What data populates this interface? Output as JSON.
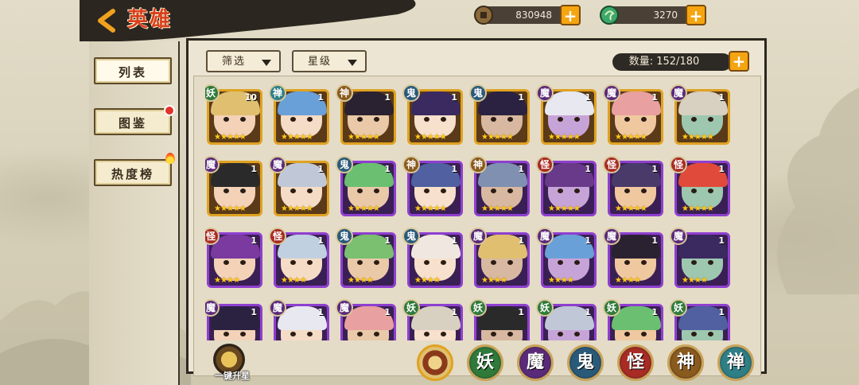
{
  "header": {
    "title": "英雄",
    "coins": "830948",
    "jade": "3270",
    "plus_label": "+"
  },
  "sidebar": {
    "items": [
      {
        "label": "列表"
      },
      {
        "label": "图鉴"
      },
      {
        "label": "热度榜"
      }
    ]
  },
  "filters": {
    "filter_label": "筛选",
    "star_label": "星级"
  },
  "count": {
    "text": "数量: 152/180"
  },
  "heroes": [
    {
      "faction": "妖",
      "level": "10",
      "frame": "gold",
      "stars": "★★★★★"
    },
    {
      "faction": "禅",
      "level": "1",
      "frame": "gold",
      "stars": "★★★★★"
    },
    {
      "faction": "神",
      "level": "1",
      "frame": "gold",
      "stars": "★★★★★"
    },
    {
      "faction": "鬼",
      "level": "1",
      "frame": "gold",
      "stars": "★★★★★"
    },
    {
      "faction": "鬼",
      "level": "1",
      "frame": "gold",
      "stars": "★★★★★"
    },
    {
      "faction": "魔",
      "level": "1",
      "frame": "gold",
      "stars": "★★★★★"
    },
    {
      "faction": "魔",
      "level": "1",
      "frame": "gold",
      "stars": "★★★★★"
    },
    {
      "faction": "魔",
      "level": "1",
      "frame": "gold",
      "stars": "★★★★★"
    },
    {
      "faction": "魔",
      "level": "1",
      "frame": "gold",
      "stars": "★★★★★"
    },
    {
      "faction": "魔",
      "level": "1",
      "frame": "gold",
      "stars": "★★★★★"
    },
    {
      "faction": "鬼",
      "level": "1",
      "frame": "purple",
      "stars": "★★★★★"
    },
    {
      "faction": "神",
      "level": "1",
      "frame": "purple",
      "stars": "★★★★★"
    },
    {
      "faction": "神",
      "level": "1",
      "frame": "purple",
      "stars": "★★★★★"
    },
    {
      "faction": "怪",
      "level": "1",
      "frame": "purple",
      "stars": "★★★★★"
    },
    {
      "faction": "怪",
      "level": "1",
      "frame": "purple",
      "stars": "★★★★★"
    },
    {
      "faction": "怪",
      "level": "1",
      "frame": "purple",
      "stars": "★★★★★"
    },
    {
      "faction": "怪",
      "level": "1",
      "frame": "purple",
      "stars": "★★★★"
    },
    {
      "faction": "怪",
      "level": "1",
      "frame": "purple",
      "stars": "★★★★"
    },
    {
      "faction": "鬼",
      "level": "1",
      "frame": "purple",
      "stars": "★★★★"
    },
    {
      "faction": "鬼",
      "level": "1",
      "frame": "purple",
      "stars": "★★★★"
    },
    {
      "faction": "魔",
      "level": "1",
      "frame": "purple",
      "stars": "★★★★"
    },
    {
      "faction": "魔",
      "level": "1",
      "frame": "purple",
      "stars": "★★★★"
    },
    {
      "faction": "魔",
      "level": "1",
      "frame": "purple",
      "stars": "★★★★"
    },
    {
      "faction": "魔",
      "level": "1",
      "frame": "purple",
      "stars": "★★★★"
    },
    {
      "faction": "魔",
      "level": "1",
      "frame": "purple",
      "stars": ""
    },
    {
      "faction": "魔",
      "level": "1",
      "frame": "purple",
      "stars": ""
    },
    {
      "faction": "魔",
      "level": "1",
      "frame": "purple",
      "stars": ""
    },
    {
      "faction": "妖",
      "level": "1",
      "frame": "purple",
      "stars": ""
    },
    {
      "faction": "妖",
      "level": "1",
      "frame": "purple",
      "stars": ""
    },
    {
      "faction": "妖",
      "level": "1",
      "frame": "purple",
      "stars": ""
    },
    {
      "faction": "妖",
      "level": "1",
      "frame": "purple",
      "stars": ""
    },
    {
      "faction": "妖",
      "level": "1",
      "frame": "purple",
      "stars": ""
    }
  ],
  "factions_colors": {
    "妖": "#2f7a3a",
    "禅": "#2f7f86",
    "神": "#8a5a1e",
    "鬼": "#2a5a7a",
    "魔": "#5a2a7a",
    "怪": "#a82b24"
  },
  "bottom": {
    "upstar_label": "一键升星",
    "filters": [
      {
        "label": "",
        "name": "all",
        "color": "#8a3a1a"
      },
      {
        "label": "妖",
        "name": "yao",
        "color": "#2f7a3a"
      },
      {
        "label": "魔",
        "name": "mo",
        "color": "#5a2a7a"
      },
      {
        "label": "鬼",
        "name": "gui",
        "color": "#2a5a7a"
      },
      {
        "label": "怪",
        "name": "guai",
        "color": "#a82b24"
      },
      {
        "label": "神",
        "name": "shen",
        "color": "#8a5a1e"
      },
      {
        "label": "禅",
        "name": "chan",
        "color": "#2f7f86"
      }
    ]
  }
}
